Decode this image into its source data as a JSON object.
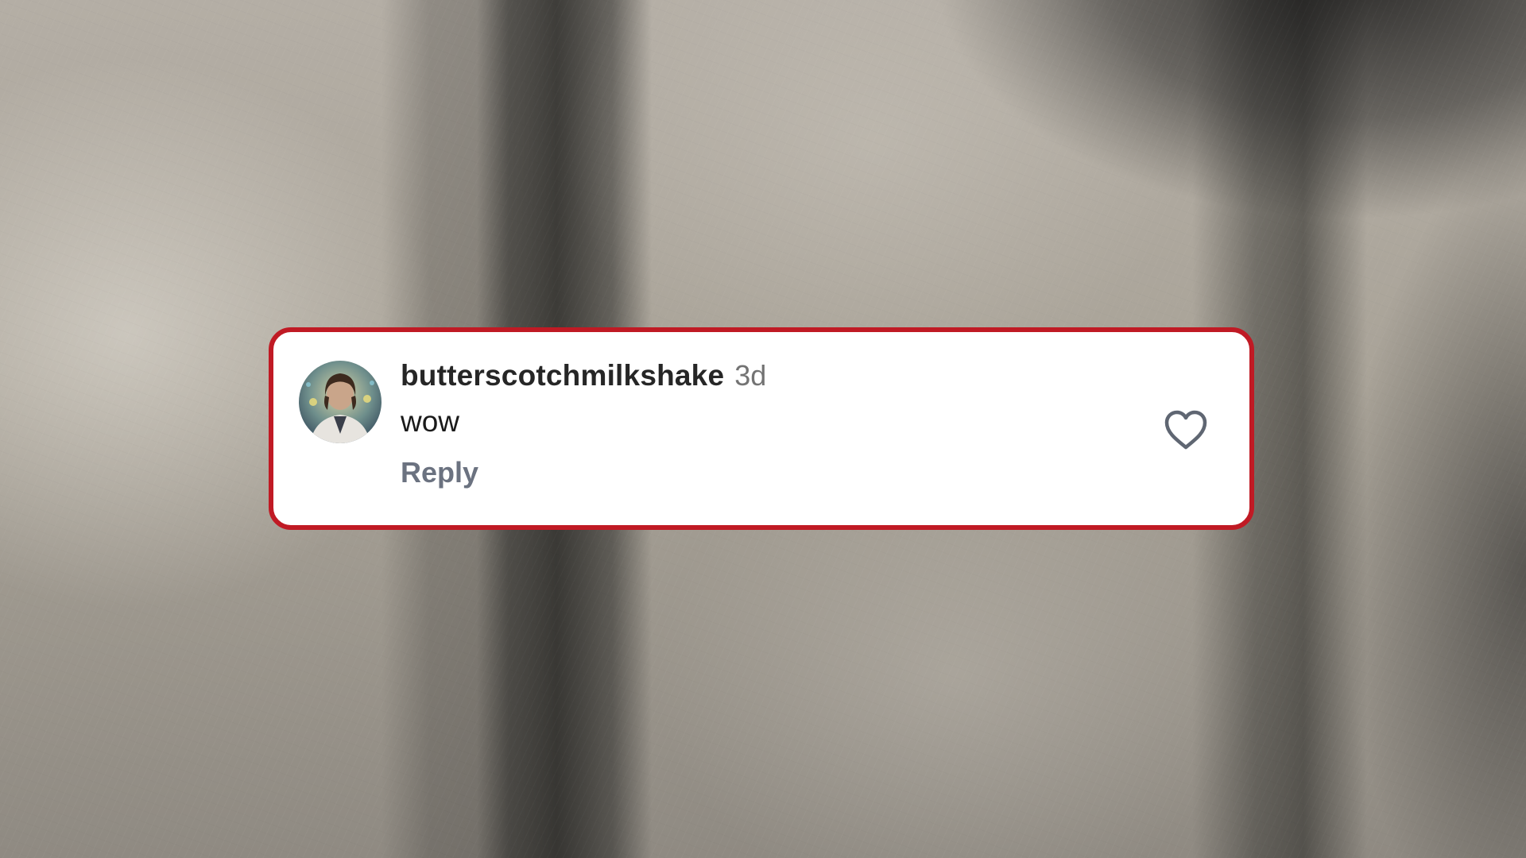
{
  "comment": {
    "username": "butterscotchmilkshake",
    "timestamp": "3d",
    "text": "wow",
    "reply_label": "Reply",
    "liked": false
  },
  "icons": {
    "like": "heart-outline-icon",
    "avatar": "user-avatar"
  },
  "colors": {
    "card_border": "#c01a24",
    "card_background": "#ffffff",
    "username": "#262626",
    "timestamp": "#737373",
    "reply": "#6b7280"
  }
}
